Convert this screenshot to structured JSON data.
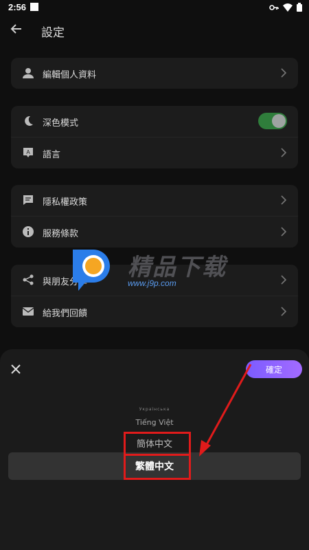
{
  "status": {
    "time": "2:56"
  },
  "appbar": {
    "title": "設定"
  },
  "groups": [
    {
      "items": [
        {
          "label": "編輯個人資料",
          "icon": "person-icon"
        }
      ]
    },
    {
      "items": [
        {
          "label": "深色模式",
          "icon": "moon-icon",
          "toggle": true
        },
        {
          "label": "語言",
          "icon": "language-icon"
        }
      ]
    },
    {
      "items": [
        {
          "label": "隱私權政策",
          "icon": "message-icon"
        },
        {
          "label": "服務條款",
          "icon": "info-icon"
        }
      ]
    },
    {
      "items": [
        {
          "label": "與朋友分享",
          "icon": "share-icon"
        },
        {
          "label": "給我們回饋",
          "icon": "mail-icon"
        }
      ]
    }
  ],
  "watermark": {
    "brand": "精品下载",
    "url": "www.j9p.com"
  },
  "sheet": {
    "confirm_label": "確定",
    "options": [
      "Українська",
      "Tiếng Việt",
      "簡体中文",
      "繁體中文"
    ],
    "selected": "繁體中文"
  },
  "colors": {
    "accent": "#8a63ff",
    "toggle_on": "#2f7d3b",
    "highlight": "#e01b1b"
  }
}
